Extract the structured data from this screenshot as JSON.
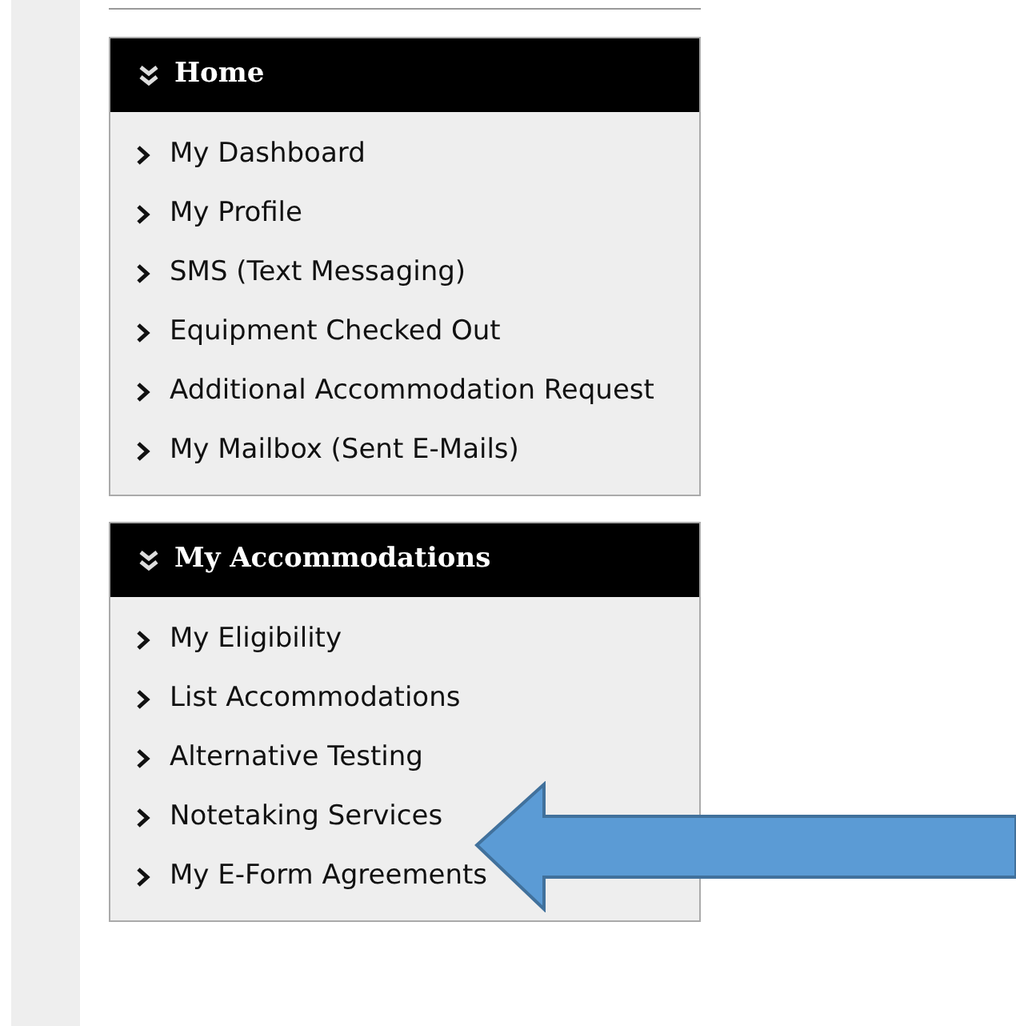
{
  "panels": [
    {
      "title": "Home",
      "items": [
        {
          "label": "My Dashboard"
        },
        {
          "label": "My Profile"
        },
        {
          "label": "SMS (Text Messaging)"
        },
        {
          "label": "Equipment Checked Out"
        },
        {
          "label": "Additional Accommodation Request"
        },
        {
          "label": "My Mailbox (Sent E-Mails)"
        }
      ]
    },
    {
      "title": "My Accommodations",
      "items": [
        {
          "label": "My Eligibility"
        },
        {
          "label": "List Accommodations"
        },
        {
          "label": "Alternative Testing"
        },
        {
          "label": "Notetaking Services"
        },
        {
          "label": "My E-Form Agreements"
        }
      ]
    }
  ]
}
